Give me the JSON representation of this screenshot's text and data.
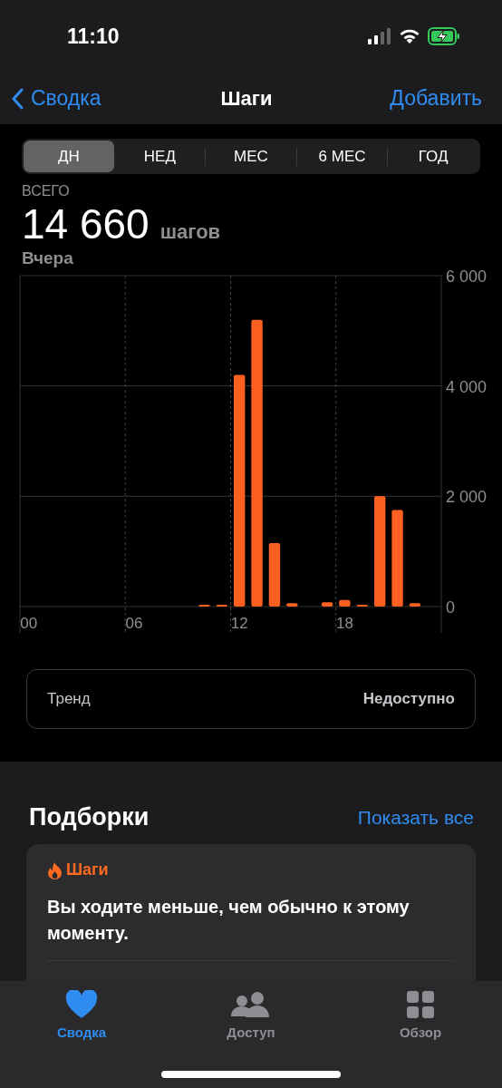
{
  "status_bar": {
    "time": "11:10"
  },
  "nav": {
    "back": "Сводка",
    "title": "Шаги",
    "action": "Добавить"
  },
  "segments": [
    {
      "label": "ДН",
      "selected": true
    },
    {
      "label": "НЕД",
      "selected": false
    },
    {
      "label": "МЕС",
      "selected": false
    },
    {
      "label": "6 МЕС",
      "selected": false
    },
    {
      "label": "ГОД",
      "selected": false
    }
  ],
  "summary": {
    "caption": "ВСЕГО",
    "value": "14 660",
    "unit": "шагов",
    "period": "Вчера"
  },
  "chart": {
    "chart_data": {
      "type": "bar",
      "x": [
        0,
        1,
        2,
        3,
        4,
        5,
        6,
        7,
        8,
        9,
        10,
        11,
        12,
        13,
        14,
        15,
        16,
        17,
        18,
        19,
        20,
        21,
        22,
        23
      ],
      "xlim": [
        -0.5,
        23.5
      ],
      "series": [
        {
          "color": "#ff5f1f",
          "values": [
            0,
            0,
            0,
            0,
            0,
            0,
            0,
            0,
            0,
            0,
            20,
            20,
            4200,
            5200,
            1150,
            60,
            0,
            80,
            120,
            20,
            2000,
            1750,
            60,
            0
          ]
        }
      ],
      "xticks": [
        {
          "value": 0,
          "label": "00"
        },
        {
          "value": 6,
          "label": "06"
        },
        {
          "value": 12,
          "label": "12"
        },
        {
          "value": 18,
          "label": "18"
        }
      ],
      "ylim": [
        0,
        6000
      ],
      "yticks": [
        {
          "value": 0,
          "label": "0"
        },
        {
          "value": 2000,
          "label": "2 000"
        },
        {
          "value": 4000,
          "label": "4 000"
        },
        {
          "value": 6000,
          "label": "6 000"
        }
      ]
    }
  },
  "trend": {
    "label": "Тренд",
    "value": "Недоступно"
  },
  "highlights": {
    "title": "Подборки",
    "show_all": "Показать все",
    "card": {
      "category": "Шаги",
      "message": "Вы ходите меньше, чем обычно к этому моменту."
    }
  },
  "tab_bar": [
    {
      "label": "Сводка",
      "kind": "heart",
      "selected": true
    },
    {
      "label": "Доступ",
      "kind": "people",
      "selected": false
    },
    {
      "label": "Обзор",
      "kind": "grid",
      "selected": false
    }
  ]
}
